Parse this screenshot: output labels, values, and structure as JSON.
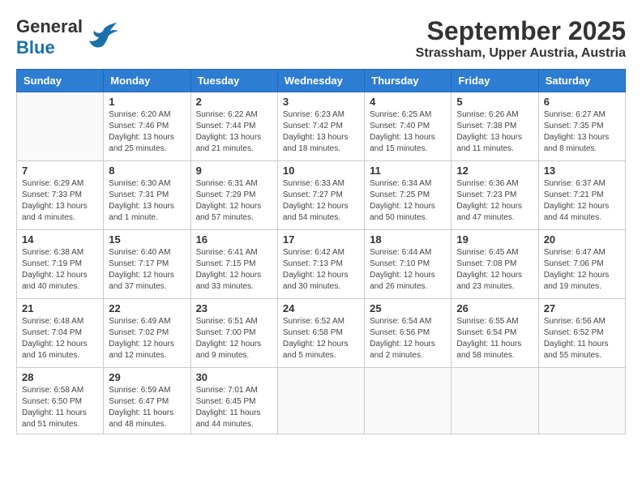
{
  "header": {
    "logo_general": "General",
    "logo_blue": "Blue",
    "month_title": "September 2025",
    "location": "Strassham, Upper Austria, Austria"
  },
  "days_of_week": [
    "Sunday",
    "Monday",
    "Tuesday",
    "Wednesday",
    "Thursday",
    "Friday",
    "Saturday"
  ],
  "weeks": [
    [
      {
        "day": "",
        "sunrise": "",
        "sunset": "",
        "daylight": ""
      },
      {
        "day": "1",
        "sunrise": "Sunrise: 6:20 AM",
        "sunset": "Sunset: 7:46 PM",
        "daylight": "Daylight: 13 hours and 25 minutes."
      },
      {
        "day": "2",
        "sunrise": "Sunrise: 6:22 AM",
        "sunset": "Sunset: 7:44 PM",
        "daylight": "Daylight: 13 hours and 21 minutes."
      },
      {
        "day": "3",
        "sunrise": "Sunrise: 6:23 AM",
        "sunset": "Sunset: 7:42 PM",
        "daylight": "Daylight: 13 hours and 18 minutes."
      },
      {
        "day": "4",
        "sunrise": "Sunrise: 6:25 AM",
        "sunset": "Sunset: 7:40 PM",
        "daylight": "Daylight: 13 hours and 15 minutes."
      },
      {
        "day": "5",
        "sunrise": "Sunrise: 6:26 AM",
        "sunset": "Sunset: 7:38 PM",
        "daylight": "Daylight: 13 hours and 11 minutes."
      },
      {
        "day": "6",
        "sunrise": "Sunrise: 6:27 AM",
        "sunset": "Sunset: 7:35 PM",
        "daylight": "Daylight: 13 hours and 8 minutes."
      }
    ],
    [
      {
        "day": "7",
        "sunrise": "Sunrise: 6:29 AM",
        "sunset": "Sunset: 7:33 PM",
        "daylight": "Daylight: 13 hours and 4 minutes."
      },
      {
        "day": "8",
        "sunrise": "Sunrise: 6:30 AM",
        "sunset": "Sunset: 7:31 PM",
        "daylight": "Daylight: 13 hours and 1 minute."
      },
      {
        "day": "9",
        "sunrise": "Sunrise: 6:31 AM",
        "sunset": "Sunset: 7:29 PM",
        "daylight": "Daylight: 12 hours and 57 minutes."
      },
      {
        "day": "10",
        "sunrise": "Sunrise: 6:33 AM",
        "sunset": "Sunset: 7:27 PM",
        "daylight": "Daylight: 12 hours and 54 minutes."
      },
      {
        "day": "11",
        "sunrise": "Sunrise: 6:34 AM",
        "sunset": "Sunset: 7:25 PM",
        "daylight": "Daylight: 12 hours and 50 minutes."
      },
      {
        "day": "12",
        "sunrise": "Sunrise: 6:36 AM",
        "sunset": "Sunset: 7:23 PM",
        "daylight": "Daylight: 12 hours and 47 minutes."
      },
      {
        "day": "13",
        "sunrise": "Sunrise: 6:37 AM",
        "sunset": "Sunset: 7:21 PM",
        "daylight": "Daylight: 12 hours and 44 minutes."
      }
    ],
    [
      {
        "day": "14",
        "sunrise": "Sunrise: 6:38 AM",
        "sunset": "Sunset: 7:19 PM",
        "daylight": "Daylight: 12 hours and 40 minutes."
      },
      {
        "day": "15",
        "sunrise": "Sunrise: 6:40 AM",
        "sunset": "Sunset: 7:17 PM",
        "daylight": "Daylight: 12 hours and 37 minutes."
      },
      {
        "day": "16",
        "sunrise": "Sunrise: 6:41 AM",
        "sunset": "Sunset: 7:15 PM",
        "daylight": "Daylight: 12 hours and 33 minutes."
      },
      {
        "day": "17",
        "sunrise": "Sunrise: 6:42 AM",
        "sunset": "Sunset: 7:13 PM",
        "daylight": "Daylight: 12 hours and 30 minutes."
      },
      {
        "day": "18",
        "sunrise": "Sunrise: 6:44 AM",
        "sunset": "Sunset: 7:10 PM",
        "daylight": "Daylight: 12 hours and 26 minutes."
      },
      {
        "day": "19",
        "sunrise": "Sunrise: 6:45 AM",
        "sunset": "Sunset: 7:08 PM",
        "daylight": "Daylight: 12 hours and 23 minutes."
      },
      {
        "day": "20",
        "sunrise": "Sunrise: 6:47 AM",
        "sunset": "Sunset: 7:06 PM",
        "daylight": "Daylight: 12 hours and 19 minutes."
      }
    ],
    [
      {
        "day": "21",
        "sunrise": "Sunrise: 6:48 AM",
        "sunset": "Sunset: 7:04 PM",
        "daylight": "Daylight: 12 hours and 16 minutes."
      },
      {
        "day": "22",
        "sunrise": "Sunrise: 6:49 AM",
        "sunset": "Sunset: 7:02 PM",
        "daylight": "Daylight: 12 hours and 12 minutes."
      },
      {
        "day": "23",
        "sunrise": "Sunrise: 6:51 AM",
        "sunset": "Sunset: 7:00 PM",
        "daylight": "Daylight: 12 hours and 9 minutes."
      },
      {
        "day": "24",
        "sunrise": "Sunrise: 6:52 AM",
        "sunset": "Sunset: 6:58 PM",
        "daylight": "Daylight: 12 hours and 5 minutes."
      },
      {
        "day": "25",
        "sunrise": "Sunrise: 6:54 AM",
        "sunset": "Sunset: 6:56 PM",
        "daylight": "Daylight: 12 hours and 2 minutes."
      },
      {
        "day": "26",
        "sunrise": "Sunrise: 6:55 AM",
        "sunset": "Sunset: 6:54 PM",
        "daylight": "Daylight: 11 hours and 58 minutes."
      },
      {
        "day": "27",
        "sunrise": "Sunrise: 6:56 AM",
        "sunset": "Sunset: 6:52 PM",
        "daylight": "Daylight: 11 hours and 55 minutes."
      }
    ],
    [
      {
        "day": "28",
        "sunrise": "Sunrise: 6:58 AM",
        "sunset": "Sunset: 6:50 PM",
        "daylight": "Daylight: 11 hours and 51 minutes."
      },
      {
        "day": "29",
        "sunrise": "Sunrise: 6:59 AM",
        "sunset": "Sunset: 6:47 PM",
        "daylight": "Daylight: 11 hours and 48 minutes."
      },
      {
        "day": "30",
        "sunrise": "Sunrise: 7:01 AM",
        "sunset": "Sunset: 6:45 PM",
        "daylight": "Daylight: 11 hours and 44 minutes."
      },
      {
        "day": "",
        "sunrise": "",
        "sunset": "",
        "daylight": ""
      },
      {
        "day": "",
        "sunrise": "",
        "sunset": "",
        "daylight": ""
      },
      {
        "day": "",
        "sunrise": "",
        "sunset": "",
        "daylight": ""
      },
      {
        "day": "",
        "sunrise": "",
        "sunset": "",
        "daylight": ""
      }
    ]
  ]
}
